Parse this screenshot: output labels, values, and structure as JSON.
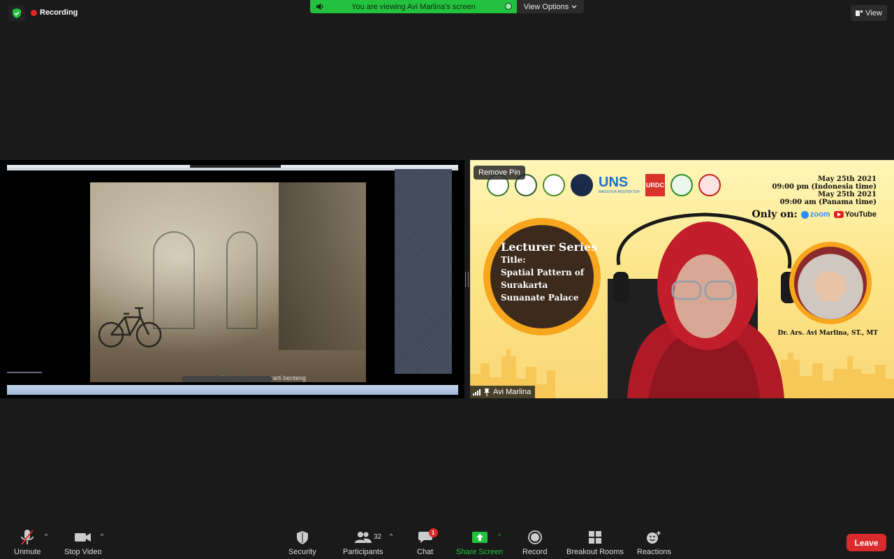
{
  "top": {
    "recording_label": "Recording",
    "viewing_banner": "You are viewing Avi Marlina's screen",
    "view_options_label": "View Options",
    "view_button_label": "View"
  },
  "shared_screen": {
    "subtitle": "'baluarte' yang berarti benteng"
  },
  "speaker": {
    "remove_pin_label": "Remove Pin",
    "name": "Avi Marlina",
    "slide": {
      "uns_label": "UNS",
      "uns_sub": "MAGISTER ARSITEKTUR",
      "urdc_label": "URDC",
      "date1": "May 25th 2021",
      "time1": "09:00 pm (Indonesia time)",
      "date2": "May 25th 2021",
      "time2": "09:00 am (Panama time)",
      "only_on": "Only on:",
      "zoom_label": "zoom",
      "youtube_label": "YouTube",
      "series_title": "Lecturer Series",
      "title_label": "Title:",
      "title_line1": "Spatial Pattern of",
      "title_line2": "Surakarta",
      "title_line3": "Sunanate Palace",
      "presenter": "Dr. Ars. Avi Marlina, ST., MT"
    }
  },
  "toolbar": {
    "unmute": "Unmute",
    "stop_video": "Stop Video",
    "security": "Security",
    "participants": "Participants",
    "participants_count": "32",
    "chat": "Chat",
    "chat_badge": "1",
    "share_screen": "Share Screen",
    "record": "Record",
    "breakout_rooms": "Breakout Rooms",
    "reactions": "Reactions",
    "leave": "Leave"
  },
  "colors": {
    "accent_green": "#23c23e",
    "leave_red": "#d92b2b",
    "background": "#1a1a1a"
  }
}
